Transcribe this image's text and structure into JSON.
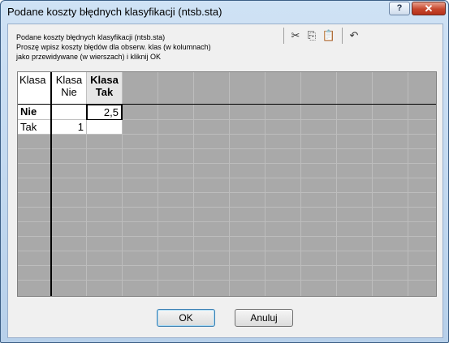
{
  "window": {
    "title": "Podane koszty błędnych klasyfikacji (ntsb.sta)",
    "help_label": "?",
    "close_label": "✕"
  },
  "description": {
    "line1": "Podane koszty błędnych klasyfikacji (ntsb.sta)",
    "line2": "Proszę wpisz koszty błędów dla obserw. klas (w kolumnach)",
    "line3": "jako przewidywane (w wierszach) i kliknij OK"
  },
  "toolbar": {
    "cut_icon": "✂",
    "copy_icon": "⎘",
    "paste_icon": "📋",
    "undo_icon": "↶"
  },
  "grid": {
    "corner_label": "Klasa",
    "columns": [
      {
        "line1": "Klasa",
        "line2": "Nie"
      },
      {
        "line1": "Klasa",
        "line2": "Tak"
      }
    ],
    "rows": [
      {
        "label": "Nie",
        "values": [
          "",
          "2,5"
        ]
      },
      {
        "label": "Tak",
        "values": [
          "1",
          ""
        ]
      }
    ]
  },
  "buttons": {
    "ok": "OK",
    "cancel": "Anuluj"
  }
}
